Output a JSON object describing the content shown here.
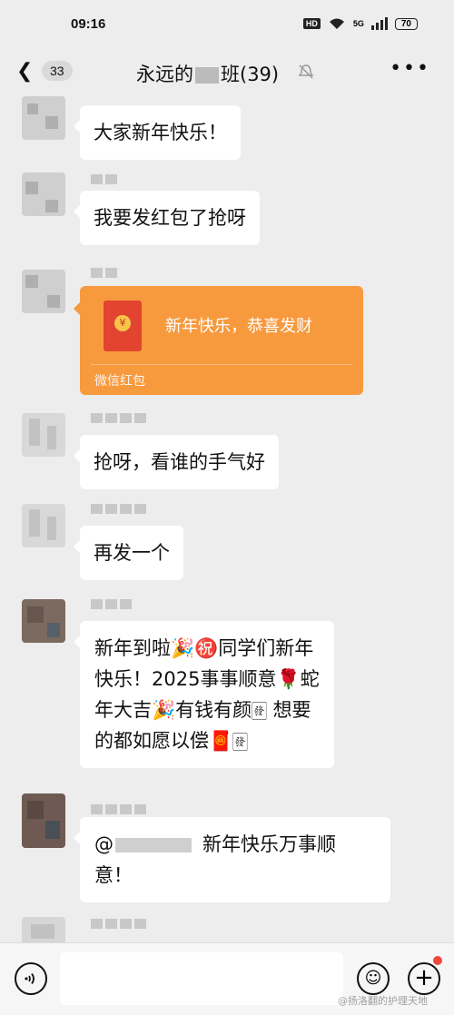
{
  "status": {
    "time": "09:16",
    "hd": "HD",
    "network": "5G",
    "battery": "70"
  },
  "header": {
    "badge_count": "33",
    "title_prefix": "永远的",
    "title_suffix": "班(39)"
  },
  "messages": [
    {
      "text": "大家新年快乐！"
    },
    {
      "text": "我要发红包了抢呀"
    },
    {
      "redpacket_title": "新年快乐，恭喜发财",
      "redpacket_label": "微信红包"
    },
    {
      "text": "抢呀，看谁的手气好"
    },
    {
      "text": "再发一个"
    },
    {
      "lines": [
        "新年到啦🎉㊗️同学们新年",
        "快乐！2025事事顺意🌹蛇",
        "年大吉🎉有钱有颜🀅 想要",
        "的都如愿以偿🧧🀅"
      ]
    },
    {
      "mention": "@",
      "lines": [
        "新年快乐万事顺",
        "意！"
      ]
    }
  ],
  "watermark": "@扬洛翻的护理天地"
}
